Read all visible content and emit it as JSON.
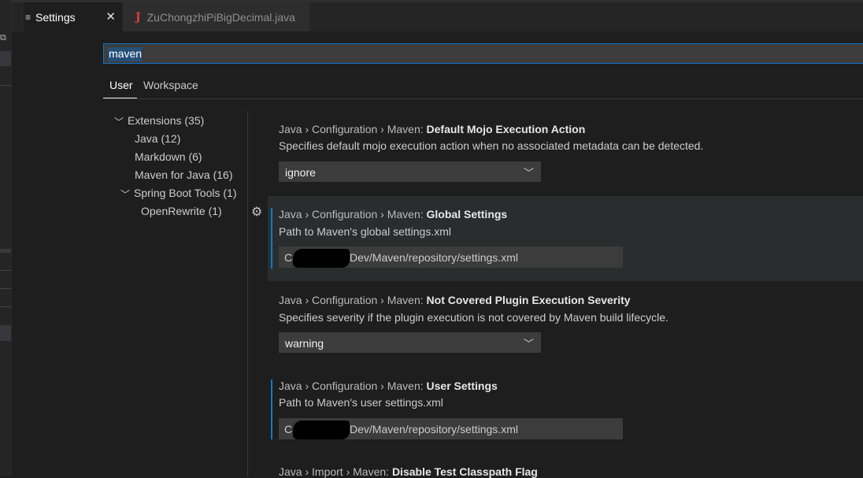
{
  "tabs": [
    {
      "label": "Settings",
      "icon": "settings-file-icon",
      "active": true
    },
    {
      "label": "ZuChongzhiPiBigDecimal.java",
      "icon": "java-file-icon",
      "active": false
    }
  ],
  "search": {
    "value": "maven"
  },
  "scopes": {
    "user": "User",
    "workspace": "Workspace"
  },
  "toc": [
    {
      "label": "Extensions (35)",
      "expanded": true
    },
    {
      "label": "Java (12)"
    },
    {
      "label": "Markdown (6)"
    },
    {
      "label": "Maven for Java (16)"
    },
    {
      "label": "Spring Boot Tools (1)",
      "expanded": true
    },
    {
      "label": "OpenRewrite (1)"
    }
  ],
  "settings": [
    {
      "category": "Java › Configuration › Maven: ",
      "key": "Default Mojo Execution Action",
      "description": "Specifies default mojo execution action when no associated metadata can be detected.",
      "value": "ignore"
    },
    {
      "category": "Java › Configuration › Maven: ",
      "key": "Global Settings",
      "description": "Path to Maven's global settings.xml",
      "value_prefix": "C:/",
      "value_suffix": "Dev/Maven/repository/settings.xml"
    },
    {
      "category": "Java › Configuration › Maven: ",
      "key": "Not Covered Plugin Execution Severity",
      "description": "Specifies severity if the plugin execution is not covered by Maven build lifecycle.",
      "value": "warning"
    },
    {
      "category": "Java › Configuration › Maven: ",
      "key": "User Settings",
      "description": "Path to Maven's user settings.xml",
      "value_prefix": "C:/",
      "value_suffix": "Dev/Maven/repository/settings.xml"
    },
    {
      "category": "Java › Import › Maven: ",
      "key": "Disable Test Classpath Flag"
    }
  ],
  "colors": {
    "accent": "#0e74c8",
    "modified_bar": "#0c7bd4",
    "java_icon": "#e03b3b"
  }
}
